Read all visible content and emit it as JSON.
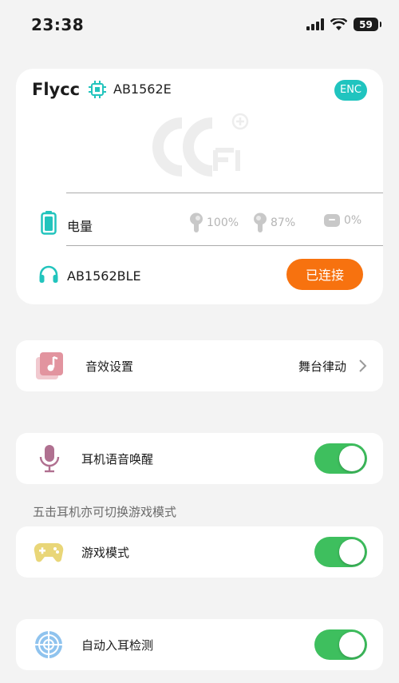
{
  "status_bar": {
    "time": "23:38",
    "battery_level": "59",
    "icons": [
      "signal-icon",
      "wifi-icon",
      "battery-icon"
    ]
  },
  "device": {
    "name": "Flycc",
    "model_id": "AB1562E",
    "enc_badge": "ENC",
    "battery_label": "电量",
    "left_pod": "100%",
    "right_pod": "87%",
    "case": "0%",
    "ble_name": "AB1562BLE",
    "connect_label": "已连接"
  },
  "sound": {
    "label": "音效设置",
    "value": "舞台律动"
  },
  "voice_wake": {
    "label": "耳机语音唤醒",
    "enabled": true
  },
  "hint": "五击耳机亦可切换游戏模式",
  "game_mode": {
    "label": "游戏模式",
    "enabled": true
  },
  "auto_ear": {
    "label": "自动入耳检测",
    "enabled": true
  },
  "colors": {
    "accent_orange": "#f7720f",
    "toggle_green": "#3ebf5e",
    "enc_teal": "#20c4bf"
  }
}
